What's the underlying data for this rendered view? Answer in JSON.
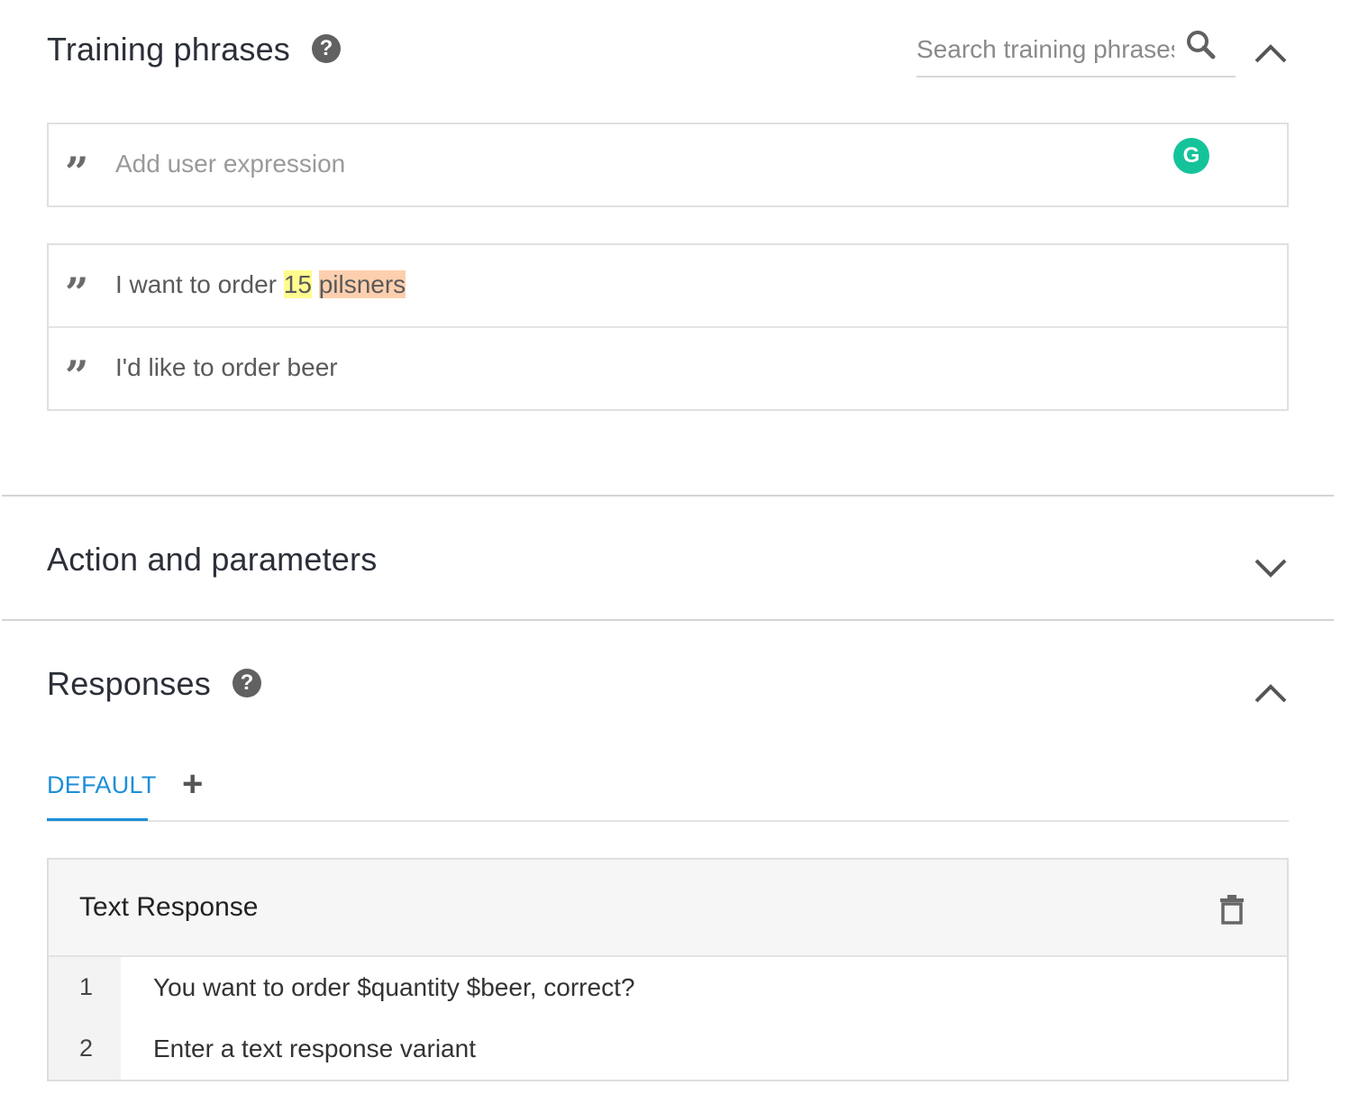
{
  "training_phrases": {
    "title": "Training phrases",
    "search_placeholder": "Search training phrases",
    "add_placeholder": "Add user expression",
    "phrases": [
      {
        "before": "I want to order ",
        "hl1": "15",
        "sep": " ",
        "hl2": "pilsners"
      },
      {
        "text": "I'd like to order beer"
      }
    ],
    "annotation_colors": {
      "number": "#fffb8f",
      "beer": "#fdcfae"
    }
  },
  "action_parameters": {
    "title": "Action and parameters"
  },
  "responses": {
    "title": "Responses",
    "tabs": {
      "default": "DEFAULT"
    },
    "card": {
      "title": "Text Response",
      "lines": [
        {
          "no": "1",
          "text": "You want to order $quantity $beer, correct?"
        },
        {
          "no": "2",
          "placeholder": "Enter a text response variant"
        }
      ]
    }
  },
  "colors": {
    "accent": "#1b8fd8",
    "grammarly": "#15c39a"
  },
  "icons": [
    "help-icon",
    "search-icon",
    "chevron-up-icon",
    "chevron-down-icon",
    "quote-icon",
    "grammarly-icon",
    "plus-icon",
    "trash-icon"
  ]
}
